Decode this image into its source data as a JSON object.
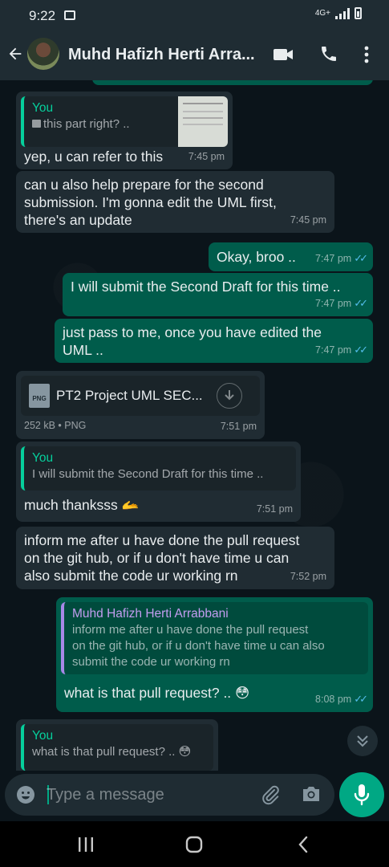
{
  "status_bar": {
    "time": "9:22",
    "network": "4G+"
  },
  "header": {
    "contact_name": "Muhd Hafizh Herti Arra..."
  },
  "messages": {
    "m1": {
      "quote_name": "You",
      "quote_text": "this part right? ..",
      "text": "yep, u can refer to this",
      "time": "7:45 pm"
    },
    "m2": {
      "line1": "can u also help prepare for the second",
      "line2": "submission. I'm gonna edit the UML first,",
      "line3": "there's an update",
      "time": "7:45 pm"
    },
    "m3": {
      "text": "Okay, broo ..",
      "time": "7:47 pm"
    },
    "m4": {
      "text": "I will submit the Second Draft for this time ..",
      "time": "7:47 pm"
    },
    "m5": {
      "line1": "just pass to me, once you have edited the",
      "line2": "UML ..",
      "time": "7:47 pm"
    },
    "m6": {
      "file_type": "PNG",
      "file_name": "PT2 Project UML SEC...",
      "file_info": "252 kB • PNG",
      "time": "7:51 pm"
    },
    "m7": {
      "quote_name": "You",
      "quote_text": "I will submit the Second Draft for this time ..",
      "text": "much thanksss 🫴",
      "time": "7:51 pm"
    },
    "m8": {
      "line1": "inform me after u have done the pull request",
      "line2": "on the git hub, or if u don't have time u can",
      "line3": "also submit the code ur working rn",
      "time": "7:52 pm"
    },
    "m9": {
      "quote_name": "Muhd Hafizh Herti Arrabbani",
      "quote_line1": "inform me after u have done the pull request",
      "quote_line2": "on the git hub, or if u don't have time u can also",
      "quote_line3": "submit the code ur working rn",
      "text": "what is that pull request? .. 😳",
      "time": "8:08 pm"
    },
    "m10": {
      "quote_name": "You",
      "quote_text": "what is that pull request? .. 😳"
    }
  },
  "composer": {
    "placeholder": "Type a message"
  },
  "colors": {
    "header": "#1f2c33",
    "incoming": "#202c33",
    "outgoing": "#005c4b",
    "accent": "#00a884",
    "read_ticks": "#53bdeb"
  }
}
